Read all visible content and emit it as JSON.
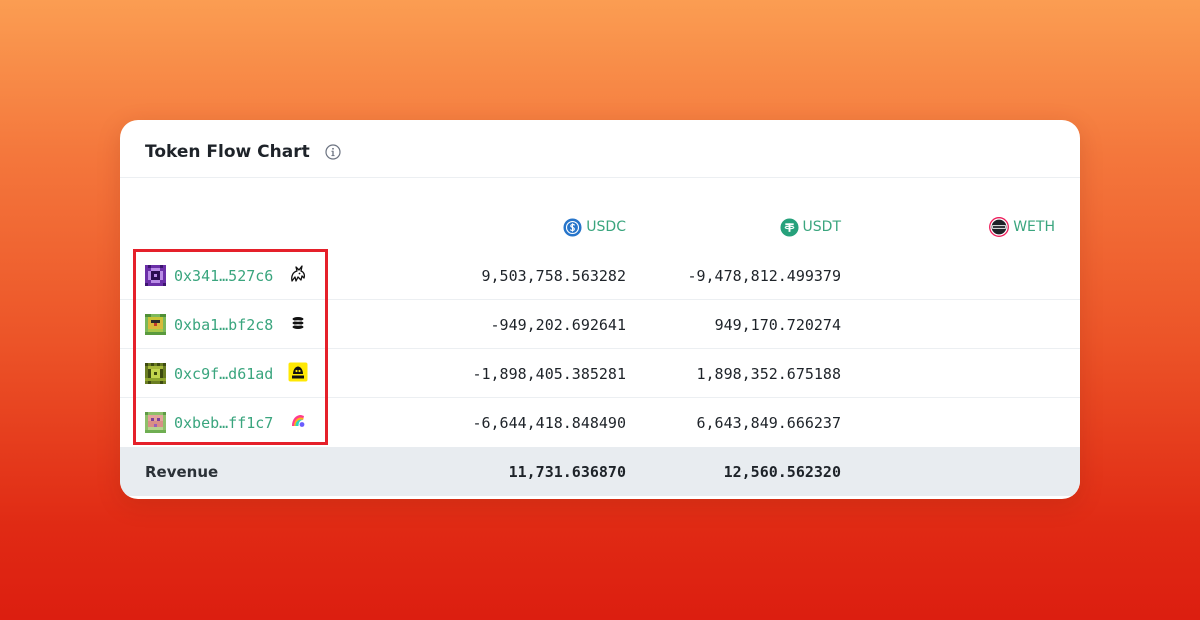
{
  "header": {
    "title": "Token Flow Chart"
  },
  "columns": [
    {
      "symbol": "USDC",
      "icon": "usdc-coin-icon",
      "color": "#2775ca"
    },
    {
      "symbol": "USDT",
      "icon": "usdt-coin-icon",
      "color": "#26a17b"
    },
    {
      "symbol": "WETH",
      "icon": "weth-coin-icon",
      "color": "#ec1c5a"
    }
  ],
  "rows": [
    {
      "address": "0x341…527c6",
      "protocol_icon": "unicorn-icon",
      "usdc": "9,503,758.563282",
      "usdt": "-9,478,812.499379",
      "weth": ""
    },
    {
      "address": "0xba1…bf2c8",
      "protocol_icon": "stacked-discs-icon",
      "usdc": "-949,202.692641",
      "usdt": "949,170.720274",
      "weth": ""
    },
    {
      "address": "0xc9f…d61ad",
      "protocol_icon": "dodo-icon",
      "usdc": "-1,898,405.385281",
      "usdt": "1,898,352.675188",
      "weth": ""
    },
    {
      "address": "0xbeb…ff1c7",
      "protocol_icon": "rainbow-icon",
      "usdc": "-6,644,418.848490",
      "usdt": "6,643,849.666237",
      "weth": ""
    }
  ],
  "revenue": {
    "label": "Revenue",
    "usdc": "11,731.636870",
    "usdt": "12,560.562320",
    "weth": ""
  },
  "colors": {
    "link": "#3aa57e",
    "highlight": "#e5202a",
    "revenue_bg": "#e8ecf0"
  }
}
